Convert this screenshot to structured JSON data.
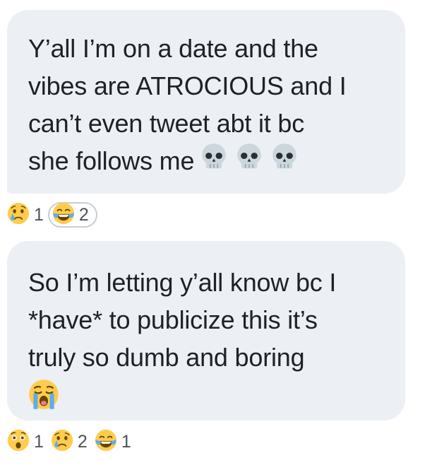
{
  "messages": [
    {
      "lines": [
        "Y’all I’m on a date and the",
        "vibes are ATROCIOUS and I",
        "can’t even tweet abt it bc",
        "she follows me"
      ],
      "trailing_emojis": [
        "skull-icon",
        "skull-icon",
        "skull-icon"
      ],
      "reactions": [
        {
          "emoji": "crying-face-icon",
          "count": "1",
          "own": false
        },
        {
          "emoji": "tears-of-joy-icon",
          "count": "2",
          "own": true
        }
      ]
    },
    {
      "lines": [
        "So I’m letting y’all know bc I",
        "*have* to publicize this it’s",
        "truly so dumb and boring"
      ],
      "trailing_emojis": [
        "loudly-crying-face-icon"
      ],
      "reactions": [
        {
          "emoji": "astonished-face-icon",
          "count": "1",
          "own": false
        },
        {
          "emoji": "crying-face-icon",
          "count": "2",
          "own": false
        },
        {
          "emoji": "tears-of-joy-icon",
          "count": "1",
          "own": false
        }
      ]
    }
  ],
  "colors": {
    "bubble_background": "#eceff3",
    "text": "#1e2126",
    "reaction_count": "#4d535a",
    "selected_reaction_border": "#c7cdd4",
    "emoji_yellow": "#ffcc4d"
  }
}
